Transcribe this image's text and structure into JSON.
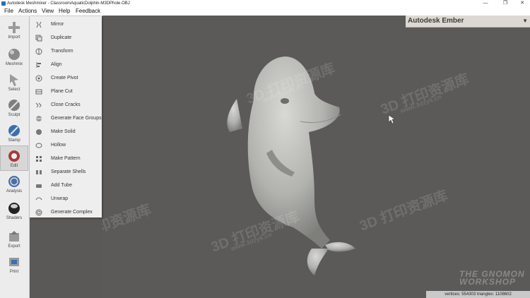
{
  "window": {
    "title": "Autodesk Meshmixer - ClassroomAquaticDolphin-M3DPhole.OBJ"
  },
  "window_controls": {
    "minimize": "—",
    "restore": "❐",
    "close": "✕"
  },
  "menu": [
    {
      "label": "File"
    },
    {
      "label": "Actions"
    },
    {
      "label": "View"
    },
    {
      "label": "Help"
    },
    {
      "label": "Feedback"
    }
  ],
  "tools": [
    {
      "label": "Import",
      "icon": "plus-icon"
    },
    {
      "label": "Meshmix",
      "icon": "sphere-icon"
    },
    {
      "label": "Select",
      "icon": "cursor-icon"
    },
    {
      "label": "Sculpt",
      "icon": "brush-icon"
    },
    {
      "label": "Stamp",
      "icon": "stamp-icon"
    },
    {
      "label": "Edit",
      "icon": "edit-icon",
      "active": true
    },
    {
      "label": "Analysis",
      "icon": "analysis-icon"
    },
    {
      "label": "Shaders",
      "icon": "shader-ball-icon"
    },
    {
      "label": "Export",
      "icon": "export-icon"
    },
    {
      "label": "Print",
      "icon": "print-icon"
    }
  ],
  "edit_menu": [
    {
      "label": "Mirror",
      "icon": "mirror-icon"
    },
    {
      "label": "Duplicate",
      "icon": "duplicate-icon"
    },
    {
      "label": "Transform",
      "icon": "transform-icon"
    },
    {
      "label": "Align",
      "icon": "align-icon"
    },
    {
      "label": "Create Pivot",
      "icon": "pivot-icon"
    },
    {
      "label": "Plane Cut",
      "icon": "plane-cut-icon"
    },
    {
      "label": "Close Cracks",
      "icon": "close-cracks-icon"
    },
    {
      "label": "Generate Face Groups",
      "icon": "face-groups-icon"
    },
    {
      "label": "Make Solid",
      "icon": "make-solid-icon"
    },
    {
      "label": "Hollow",
      "icon": "hollow-icon"
    },
    {
      "label": "Make Pattern",
      "icon": "pattern-icon"
    },
    {
      "label": "Separate Shells",
      "icon": "separate-shells-icon"
    },
    {
      "label": "Add Tube",
      "icon": "tube-icon"
    },
    {
      "label": "Unwrap",
      "icon": "unwrap-icon"
    },
    {
      "label": "Generate Complex",
      "icon": "complex-icon"
    }
  ],
  "ember": {
    "title": "Autodesk Ember",
    "arrow": "▼"
  },
  "status": {
    "text": "vertices: 554303  triangles: 1108602"
  },
  "watermark": {
    "text": "3D 打印资源库",
    "url": "www.3dzyk.cn"
  },
  "gnomon": {
    "line1": "THE GNOMON",
    "line2": "WORKSHOP"
  },
  "colors": {
    "viewport": "#5b5a58",
    "panel": "#eeeeee",
    "model": "#b5b5b1"
  }
}
